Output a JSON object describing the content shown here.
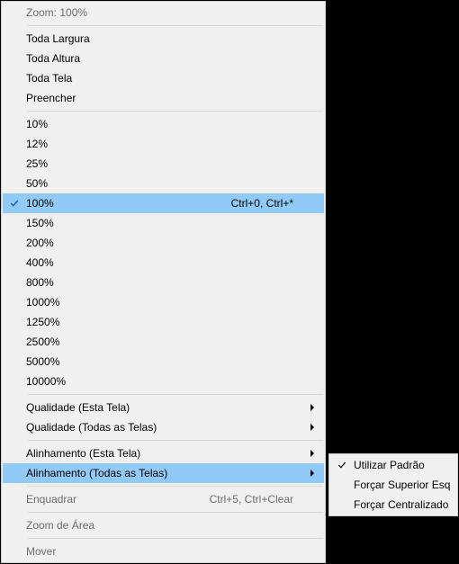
{
  "main_menu": {
    "title": "Zoom: 100%",
    "fit": {
      "width": "Toda Largura",
      "height": "Toda Altura",
      "screen": "Toda Tela",
      "fill": "Preencher"
    },
    "zoom": {
      "p10": "10%",
      "p12": "12%",
      "p25": "25%",
      "p50": "50%",
      "p100": "100%",
      "p100_shortcut": "Ctrl+0, Ctrl+*",
      "p150": "150%",
      "p200": "200%",
      "p400": "400%",
      "p800": "800%",
      "p1000": "1000%",
      "p1250": "1250%",
      "p2500": "2500%",
      "p5000": "5000%",
      "p10000": "10000%"
    },
    "quality_this": "Qualidade (Esta Tela)",
    "quality_all": "Qualidade (Todas as Telas)",
    "align_this": "Alinhamento (Esta Tela)",
    "align_all": "Alinhamento (Todas as Telas)",
    "fit_window": "Enquadrar",
    "fit_window_shortcut": "Ctrl+5, Ctrl+Clear",
    "zoom_area": "Zoom de Área",
    "move": "Mover"
  },
  "submenu": {
    "use_default": "Utilizar Padrão",
    "force_top_left": "Forçar Superior Esquerdo",
    "force_center": "Forçar Centralizado"
  }
}
